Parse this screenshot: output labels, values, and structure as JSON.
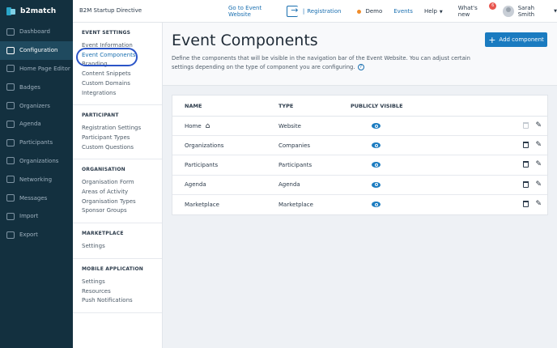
{
  "app": {
    "logo": "b2match",
    "event_name": "B2M Startup Directive"
  },
  "topnav": {
    "go_to_event": "Go to Event Website",
    "separator": "|",
    "registration": "Registration",
    "demo": "Demo",
    "events": "Events",
    "help": "Help",
    "whats_new": "What's new",
    "whats_new_count": "6",
    "user_name": "Sarah Smith"
  },
  "sidebar": {
    "items": [
      {
        "label": "Dashboard",
        "icon": "dashboard-icon"
      },
      {
        "label": "Configuration",
        "icon": "configuration-icon",
        "active": true
      },
      {
        "label": "Home Page Editor",
        "icon": "home-page-editor-icon"
      },
      {
        "label": "Badges",
        "icon": "badges-icon"
      },
      {
        "label": "Organizers",
        "icon": "organizers-icon"
      },
      {
        "label": "Agenda",
        "icon": "agenda-icon"
      },
      {
        "label": "Participants",
        "icon": "participants-icon"
      },
      {
        "label": "Organizations",
        "icon": "organizations-icon"
      },
      {
        "label": "Networking",
        "icon": "networking-icon"
      },
      {
        "label": "Messages",
        "icon": "messages-icon"
      },
      {
        "label": "Import",
        "icon": "import-icon"
      },
      {
        "label": "Export",
        "icon": "export-icon"
      }
    ]
  },
  "subnav": {
    "event_settings": {
      "title": "EVENT SETTINGS",
      "items": [
        "Event Information",
        "Event Components",
        "Branding",
        "Content Snippets",
        "Custom Domains",
        "Integrations"
      ]
    },
    "participant": {
      "title": "PARTICIPANT",
      "items": [
        "Registration Settings",
        "Participant Types",
        "Custom Questions"
      ]
    },
    "organisation": {
      "title": "ORGANISATION",
      "items": [
        "Organisation Form",
        "Areas of Activity",
        "Organisation Types",
        "Sponsor Groups"
      ]
    },
    "marketplace": {
      "title": "MARKETPLACE",
      "items": [
        "Settings"
      ]
    },
    "mobile": {
      "title": "MOBILE APPLICATION",
      "items": [
        "Settings",
        "Resources",
        "Push Notifications"
      ]
    }
  },
  "main": {
    "title": "Event Components",
    "description": "Define the components that will be visible in the navigation bar of the Event Website. You can adjust certain settings depending on the type of component you are configuring.",
    "add_button": "Add component",
    "table": {
      "headers": [
        "NAME",
        "TYPE",
        "PUBLICLY VISIBLE"
      ],
      "rows": [
        {
          "name": "Home",
          "type": "Website",
          "visible": true,
          "home": true
        },
        {
          "name": "Organizations",
          "type": "Companies",
          "visible": true
        },
        {
          "name": "Participants",
          "type": "Participants",
          "visible": true
        },
        {
          "name": "Agenda",
          "type": "Agenda",
          "visible": true
        },
        {
          "name": "Marketplace",
          "type": "Marketplace",
          "visible": true
        }
      ]
    }
  },
  "colors": {
    "sidebar": "#13303f",
    "accent": "#1a7bc0",
    "highlight_circle": "#2b55c8"
  }
}
